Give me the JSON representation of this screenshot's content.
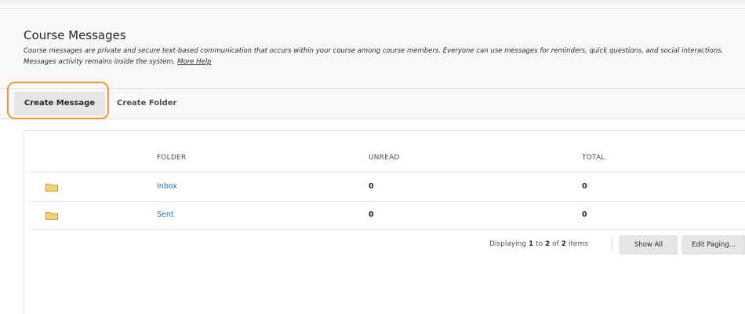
{
  "header": {
    "title": "Course Messages",
    "description": "Course messages are private and secure text-based communication that occurs within your course among course members. Everyone can use messages for reminders, quick questions, and social interactions. Messages activity remains inside the system.",
    "help_link": "More Help"
  },
  "action_bar": {
    "create_message": "Create Message",
    "create_folder": "Create Folder"
  },
  "table": {
    "columns": [
      "FOLDER",
      "UNREAD",
      "TOTAL"
    ],
    "rows": [
      {
        "icon": "folder-icon",
        "folder": "Inbox",
        "unread": "0",
        "total": "0"
      },
      {
        "icon": "folder-icon",
        "folder": "Sent",
        "unread": "0",
        "total": "0"
      }
    ]
  },
  "paging": {
    "prefix": "Displaying",
    "from": "1",
    "to_word": "to",
    "to": "2",
    "of_word": "of",
    "total": "2",
    "suffix": "items",
    "show_all": "Show All",
    "edit_paging": "Edit Paging..."
  },
  "colors": {
    "highlight": "#f29a2e",
    "link": "#1f6db3",
    "folder_icon": "#f3d46b"
  }
}
